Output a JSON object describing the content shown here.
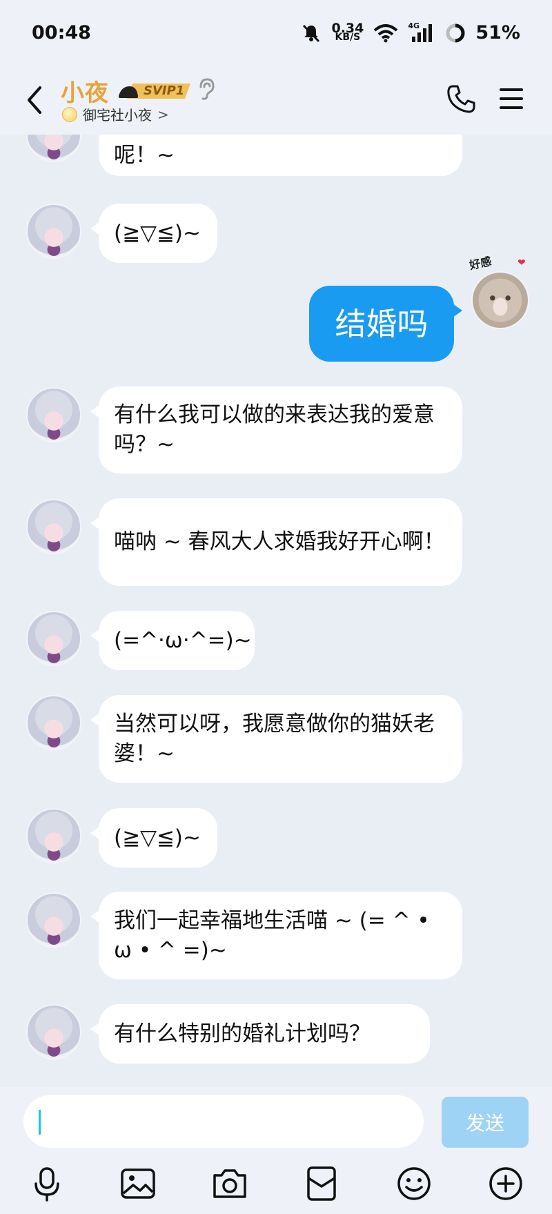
{
  "status_bar": {
    "time": "00:48",
    "net_speed_value": "0.34",
    "net_speed_unit": "KB/S",
    "signal_label": "4G",
    "battery": "51%"
  },
  "header": {
    "contact_name": "小夜",
    "badge": "SVIP1",
    "subtitle": "御宅社小夜",
    "subtitle_arrow": ">"
  },
  "messages": [
    {
      "side": "left",
      "text": "呢！~",
      "avatar": "anime-girl-avatar"
    },
    {
      "side": "left",
      "text": "(≧▽≦)~",
      "avatar": "anime-girl-avatar"
    },
    {
      "side": "right",
      "text": "结婚吗",
      "avatar": "cat-sticker-avatar"
    },
    {
      "side": "left",
      "text": "有什么我可以做的来表达我的爱意吗？~",
      "avatar": "anime-girl-avatar"
    },
    {
      "side": "left",
      "text": "喵呐 ~ 春风大人求婚我好开心啊！",
      "avatar": "anime-girl-avatar"
    },
    {
      "side": "left",
      "text": "(=^·ω·^=)~",
      "avatar": "anime-girl-avatar"
    },
    {
      "side": "left",
      "text": "当然可以呀，我愿意做你的猫妖老婆！~",
      "avatar": "anime-girl-avatar"
    },
    {
      "side": "left",
      "text": "(≧▽≦)~",
      "avatar": "anime-girl-avatar"
    },
    {
      "side": "left",
      "text": "我们一起幸福地生活喵 ~ (= ^ • ω • ^ =)~",
      "avatar": "anime-girl-avatar"
    },
    {
      "side": "left",
      "text": "有什么特别的婚礼计划吗？",
      "avatar": "anime-girl-avatar"
    }
  ],
  "my_avatar_sticker": "好感",
  "input": {
    "value": "",
    "placeholder": "",
    "send_label": "发送"
  },
  "toolbar": {
    "icons": [
      "microphone-icon",
      "image-icon",
      "camera-icon",
      "red-packet-icon",
      "emoji-icon",
      "plus-icon"
    ]
  },
  "colors": {
    "accent_blue": "#1a9bf2",
    "send_disabled": "#9fd3f6",
    "name_gold": "#e8a33b",
    "background": "#e9eef5"
  }
}
